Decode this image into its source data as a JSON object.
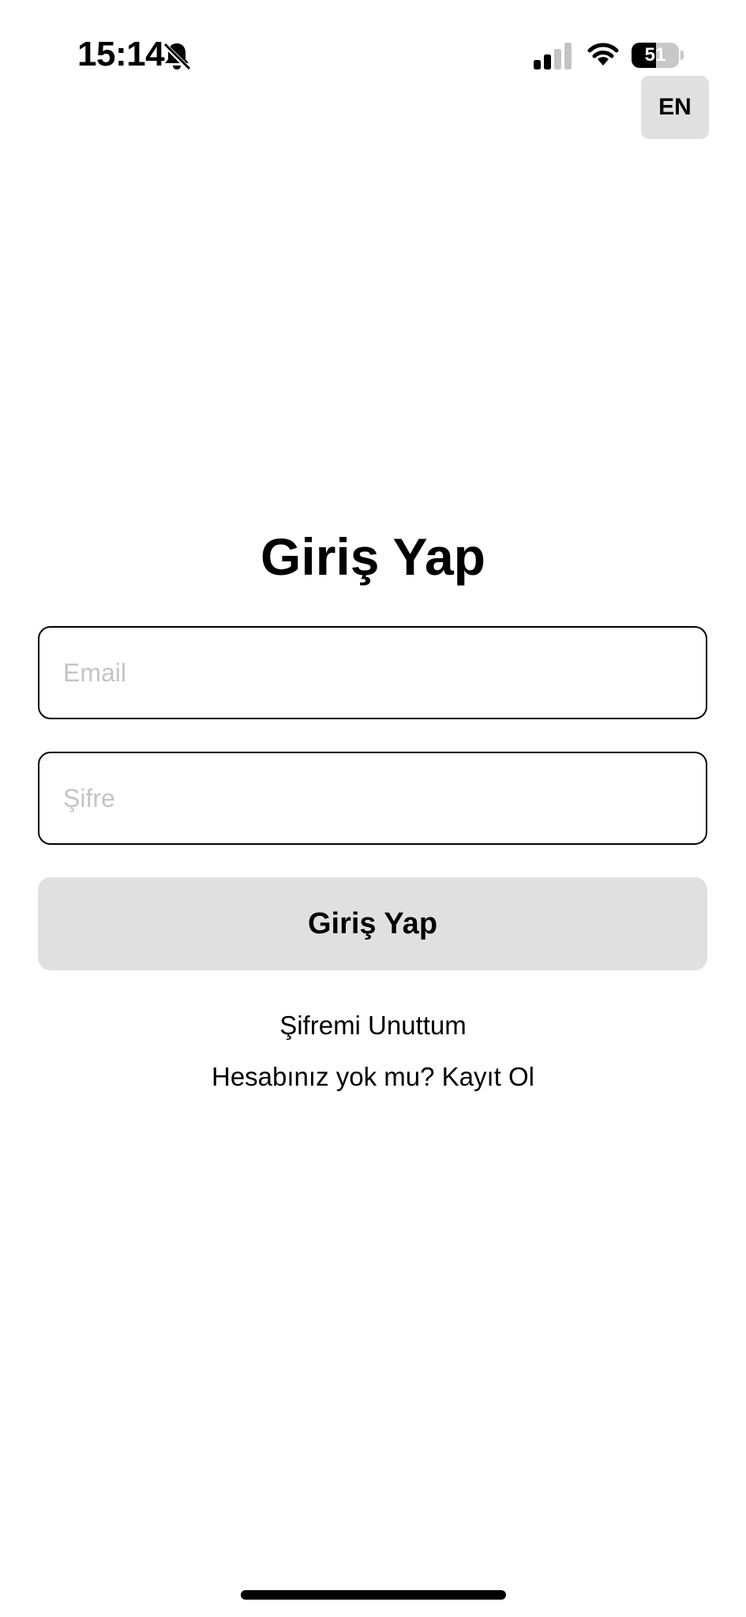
{
  "status_bar": {
    "time": "15:14",
    "battery_percent": "51",
    "battery_level": 0.51,
    "icons": [
      "bell-slash-icon",
      "cellular-signal-icon",
      "wifi-icon",
      "battery-icon"
    ]
  },
  "language_button": {
    "label": "EN"
  },
  "login": {
    "title": "Giriş Yap",
    "email_placeholder": "Email",
    "email_value": "",
    "password_placeholder": "Şifre",
    "password_value": "",
    "submit_label": "Giriş Yap",
    "forgot_password_label": "Şifremi Unuttum",
    "register_prompt": "Hesabınız yok mu? Kayıt Ol"
  },
  "colors": {
    "background": "#ffffff",
    "text": "#000000",
    "button_bg": "#e0e0e0",
    "placeholder": "#c4c4c4",
    "input_border": "#000000"
  }
}
